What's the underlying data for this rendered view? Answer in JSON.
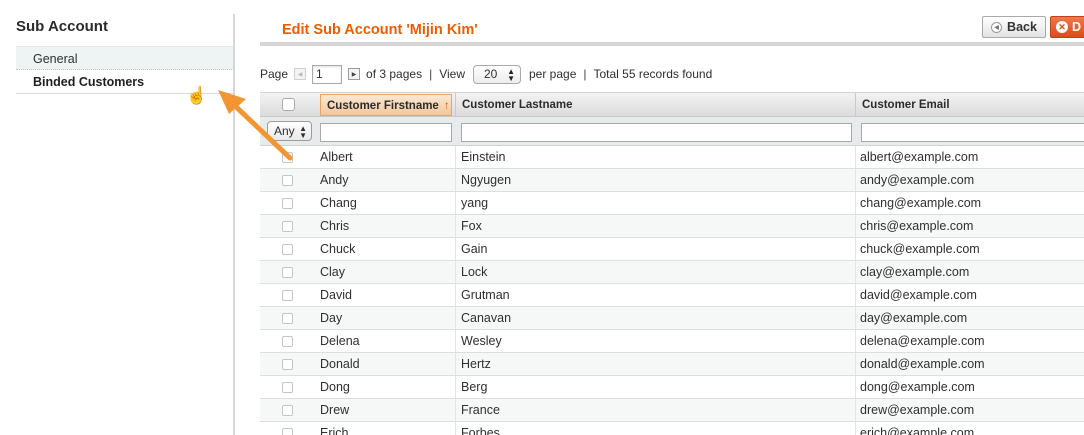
{
  "sidebar": {
    "title": "Sub Account",
    "tabs": [
      {
        "label": "General"
      },
      {
        "label": "Binded Customers"
      }
    ]
  },
  "header": {
    "title": "Edit Sub Account 'Mijin Kim'",
    "back_label": "Back",
    "delete_label": "D"
  },
  "pager": {
    "page_label": "Page",
    "page_value": "1",
    "of_pages": "of 3 pages",
    "view_label": "View",
    "view_value": "20",
    "per_page": "per page",
    "total": "Total 55 records found"
  },
  "grid": {
    "columns": [
      "Customer Firstname",
      "Customer Lastname",
      "Customer Email"
    ],
    "sort_icon": "arrow-up",
    "filter_any": "Any",
    "rows": [
      {
        "first": "Albert",
        "last": "Einstein",
        "email": "albert@example.com"
      },
      {
        "first": "Andy",
        "last": "Ngyugen",
        "email": "andy@example.com"
      },
      {
        "first": "Chang",
        "last": "yang",
        "email": "chang@example.com"
      },
      {
        "first": "Chris",
        "last": "Fox",
        "email": "chris@example.com"
      },
      {
        "first": "Chuck",
        "last": "Gain",
        "email": "chuck@example.com"
      },
      {
        "first": "Clay",
        "last": "Lock",
        "email": "clay@example.com"
      },
      {
        "first": "David",
        "last": "Grutman",
        "email": "david@example.com"
      },
      {
        "first": "Day",
        "last": "Canavan",
        "email": "day@example.com"
      },
      {
        "first": "Delena",
        "last": "Wesley",
        "email": "delena@example.com"
      },
      {
        "first": "Donald",
        "last": "Hertz",
        "email": "donald@example.com"
      },
      {
        "first": "Dong",
        "last": "Berg",
        "email": "dong@example.com"
      },
      {
        "first": "Drew",
        "last": "France",
        "email": "drew@example.com"
      },
      {
        "first": "Erich",
        "last": "Forbes",
        "email": "erich@example.com"
      }
    ]
  },
  "colors": {
    "accent": "#eb5e00",
    "annotation_arrow": "#f39530"
  }
}
